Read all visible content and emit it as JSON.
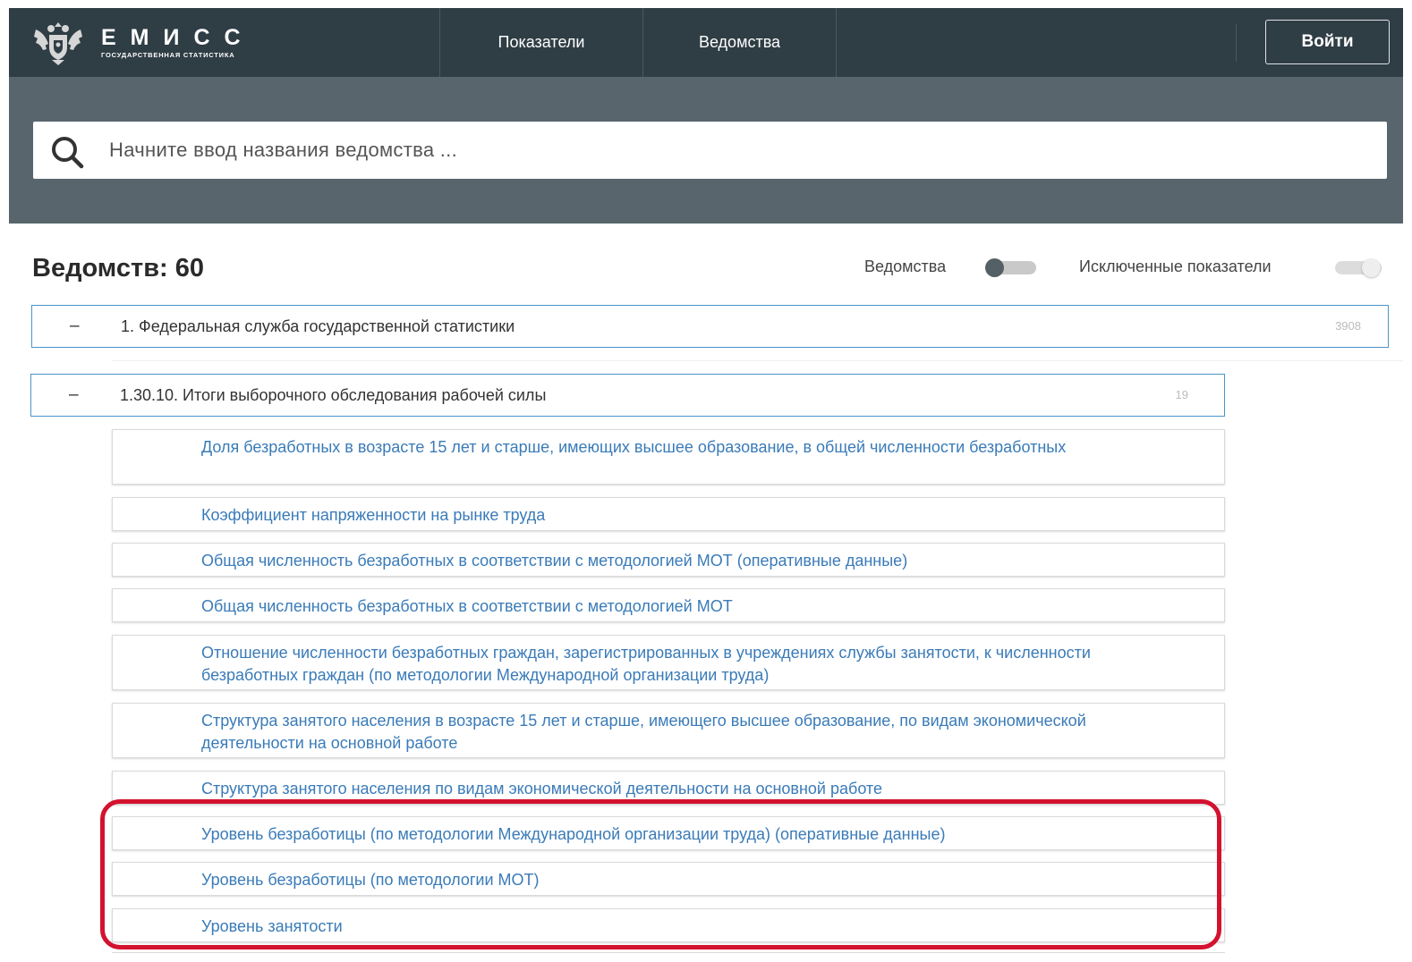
{
  "header": {
    "brand_title": "ЕМИСС",
    "brand_subtitle": "ГОСУДАРСТВЕННАЯ СТАТИСТИКА",
    "nav": [
      {
        "label": "Показатели"
      },
      {
        "label": "Ведомства"
      }
    ],
    "login_label": "Войти"
  },
  "search": {
    "placeholder": "Начните ввод названия ведомства ..."
  },
  "filters": {
    "count_title": "Ведомств: 60",
    "agencies_toggle_label": "Ведомства",
    "agencies_toggle_on": false,
    "excluded_toggle_label": "Исключенные показатели",
    "excluded_toggle_on": false
  },
  "tree": {
    "agency": {
      "toggle": "–",
      "title": "1. Федеральная служба государственной статистики",
      "count": "3908"
    },
    "section": {
      "toggle": "–",
      "title": "1.30.10. Итоги выборочного обследования рабочей силы",
      "count": "19"
    },
    "indicators": [
      {
        "label": "Доля безработных в возрасте 15 лет и старше, имеющих высшее образование, в общей численности безработных"
      },
      {
        "label": "Коэффициент напряженности на рынке труда"
      },
      {
        "label": "Общая численность безработных в соответствии с методологией МОТ (оперативные данные)"
      },
      {
        "label": "Общая численность безработных в соответствии с методологией МОТ"
      },
      {
        "label": "Отношение численности безработных граждан, зарегистрированных в учреждениях службы занятости, к численности безработных граждан (по методологии Международной организации труда)"
      },
      {
        "label": "Структура занятого населения в возрасте 15 лет и старше, имеющего высшее образование, по видам экономической деятельности на основной работе"
      },
      {
        "label": "Структура занятого населения по видам экономической деятельности на основной работе"
      },
      {
        "label": "Уровень безработицы (по методологии Международной организации труда) (оперативные данные)"
      },
      {
        "label": "Уровень безработицы (по методологии МОТ)"
      },
      {
        "label": "Уровень занятости"
      }
    ]
  },
  "colors": {
    "header_bg": "#2f3d45",
    "search_band_bg": "#58656d",
    "link": "#3a7bb8",
    "row_border": "#4b94c9",
    "highlight": "#d3122f"
  }
}
